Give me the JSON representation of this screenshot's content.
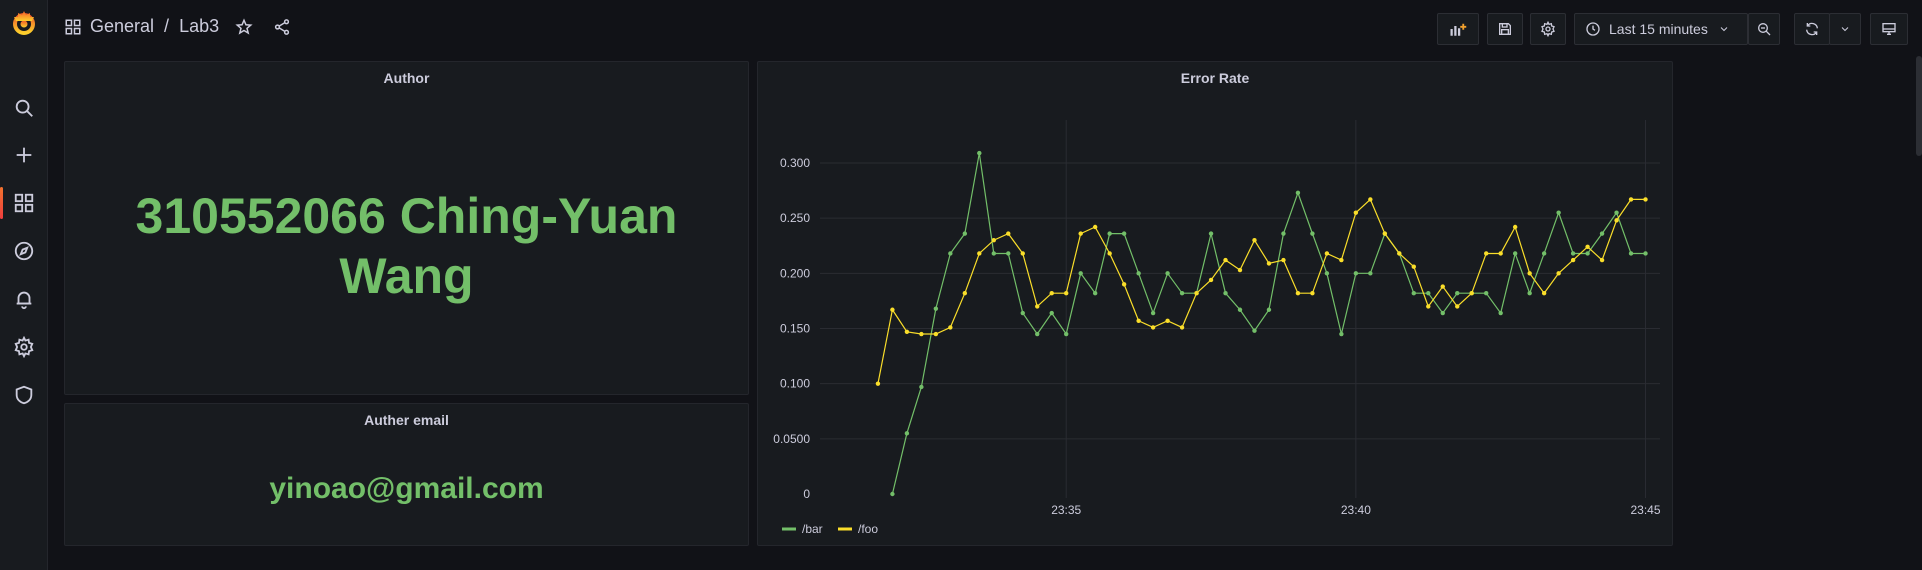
{
  "breadcrumb": {
    "folder": "General",
    "separator": "/",
    "dashboard": "Lab3"
  },
  "toolbar": {
    "time_range": "Last 15 minutes"
  },
  "panels": {
    "author": {
      "title": "Author",
      "value": "310552066 Ching-Yuan Wang",
      "line1": "310552066 Ching-Yuan",
      "line2": "Wang"
    },
    "email": {
      "title": "Auther email",
      "value": "yinoao@gmail.com"
    },
    "error_rate": {
      "title": "Error Rate"
    }
  },
  "colors": {
    "accent": "#73bf69",
    "bar": "#73bf69",
    "foo": "#fade2a",
    "background": "#111217",
    "panel": "#181b1f"
  },
  "chart_data": {
    "type": "line",
    "title": "Error Rate",
    "ylim": [
      0,
      0.3
    ],
    "y_ticks": [
      "0",
      "0.0500",
      "0.100",
      "0.150",
      "0.200",
      "0.250",
      "0.300"
    ],
    "x_ticks": [
      "23:35",
      "23:40",
      "23:45"
    ],
    "legend": "bottom-left",
    "grid": true,
    "series": [
      {
        "name": "/bar",
        "color": "#73bf69",
        "x": [
          "23:32:00",
          "23:32:15",
          "23:32:30",
          "23:32:45",
          "23:33:00",
          "23:33:15",
          "23:33:30",
          "23:33:45",
          "23:34:00",
          "23:34:15",
          "23:34:30",
          "23:34:45",
          "23:35:00",
          "23:35:15",
          "23:35:30",
          "23:35:45",
          "23:36:00",
          "23:36:15",
          "23:36:30",
          "23:36:45",
          "23:37:00",
          "23:37:15",
          "23:37:30",
          "23:37:45",
          "23:38:00",
          "23:38:15",
          "23:38:30",
          "23:38:45",
          "23:39:00",
          "23:39:15",
          "23:39:30",
          "23:39:45",
          "23:40:00",
          "23:40:15",
          "23:40:30",
          "23:40:45",
          "23:41:00",
          "23:41:15",
          "23:41:30",
          "23:41:45",
          "23:42:00",
          "23:42:15",
          "23:42:30",
          "23:42:45",
          "23:43:00",
          "23:43:15",
          "23:43:30",
          "23:43:45",
          "23:44:00",
          "23:44:15",
          "23:44:30",
          "23:44:45",
          "23:45:00"
        ],
        "values": [
          0,
          0.055,
          0.097,
          0.168,
          0.218,
          0.236,
          0.309,
          0.218,
          0.218,
          0.164,
          0.145,
          0.164,
          0.145,
          0.2,
          0.182,
          0.236,
          0.236,
          0.2,
          0.164,
          0.2,
          0.182,
          0.182,
          0.236,
          0.182,
          0.167,
          0.148,
          0.167,
          0.236,
          0.273,
          0.236,
          0.2,
          0.145,
          0.2,
          0.2,
          0.236,
          0.218,
          0.182,
          0.182,
          0.164,
          0.182,
          0.182,
          0.182,
          0.164,
          0.218,
          0.182,
          0.218,
          0.255,
          0.218,
          0.218,
          0.236,
          0.255,
          0.218,
          0.218
        ]
      },
      {
        "name": "/foo",
        "color": "#fade2a",
        "x": [
          "23:31:45",
          "23:32:00",
          "23:32:15",
          "23:32:30",
          "23:32:45",
          "23:33:00",
          "23:33:15",
          "23:33:30",
          "23:33:45",
          "23:34:00",
          "23:34:15",
          "23:34:30",
          "23:34:45",
          "23:35:00",
          "23:35:15",
          "23:35:30",
          "23:35:45",
          "23:36:00",
          "23:36:15",
          "23:36:30",
          "23:36:45",
          "23:37:00",
          "23:37:15",
          "23:37:30",
          "23:37:45",
          "23:38:00",
          "23:38:15",
          "23:38:30",
          "23:38:45",
          "23:39:00",
          "23:39:15",
          "23:39:30",
          "23:39:45",
          "23:40:00",
          "23:40:15",
          "23:40:30",
          "23:40:45",
          "23:41:00",
          "23:41:15",
          "23:41:30",
          "23:41:45",
          "23:42:00",
          "23:42:15",
          "23:42:30",
          "23:42:45",
          "23:43:00",
          "23:43:15",
          "23:43:30",
          "23:43:45",
          "23:44:00",
          "23:44:15",
          "23:44:30",
          "23:44:45",
          "23:45:00"
        ],
        "values": [
          0.1,
          0.167,
          0.147,
          0.145,
          0.145,
          0.151,
          0.182,
          0.218,
          0.23,
          0.236,
          0.218,
          0.17,
          0.182,
          0.182,
          0.236,
          0.242,
          0.218,
          0.19,
          0.157,
          0.151,
          0.157,
          0.151,
          0.182,
          0.194,
          0.212,
          0.203,
          0.23,
          0.209,
          0.212,
          0.182,
          0.182,
          0.218,
          0.212,
          0.255,
          0.267,
          0.236,
          0.218,
          0.206,
          0.17,
          0.188,
          0.17,
          0.182,
          0.218,
          0.218,
          0.242,
          0.2,
          0.182,
          0.2,
          0.212,
          0.224,
          0.212,
          0.248,
          0.267,
          0.267
        ]
      }
    ]
  }
}
